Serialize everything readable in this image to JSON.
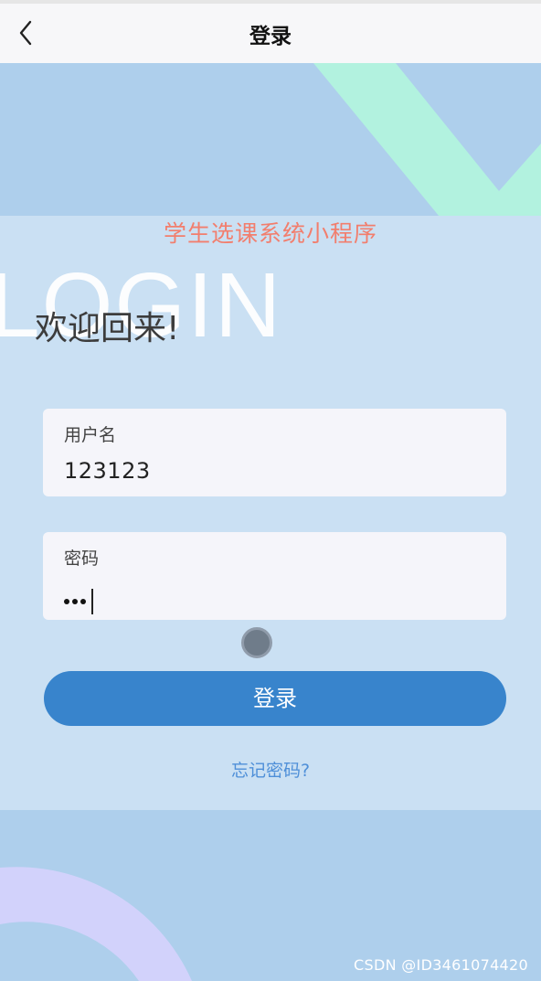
{
  "nav": {
    "title": "登录",
    "back_icon": "chevron-left-icon"
  },
  "app_title": "学生选课系统小程序",
  "background_text": "LOGIN",
  "welcome": "欢迎回来!",
  "form": {
    "username": {
      "label": "用户名",
      "value": "123123"
    },
    "password": {
      "label": "密码",
      "masked_length": 3
    }
  },
  "login_button": "登录",
  "forgot_link": "忘记密码?",
  "watermark": "CSDN @ID3461074420",
  "colors": {
    "page_bg": "#aecfec",
    "panel_bg": "#cae0f3",
    "accent_green": "#b2f2df",
    "accent_purple": "#d2d2fb",
    "button": "#3884cc",
    "app_title": "#f27e6d",
    "link": "#4e8fd8"
  }
}
